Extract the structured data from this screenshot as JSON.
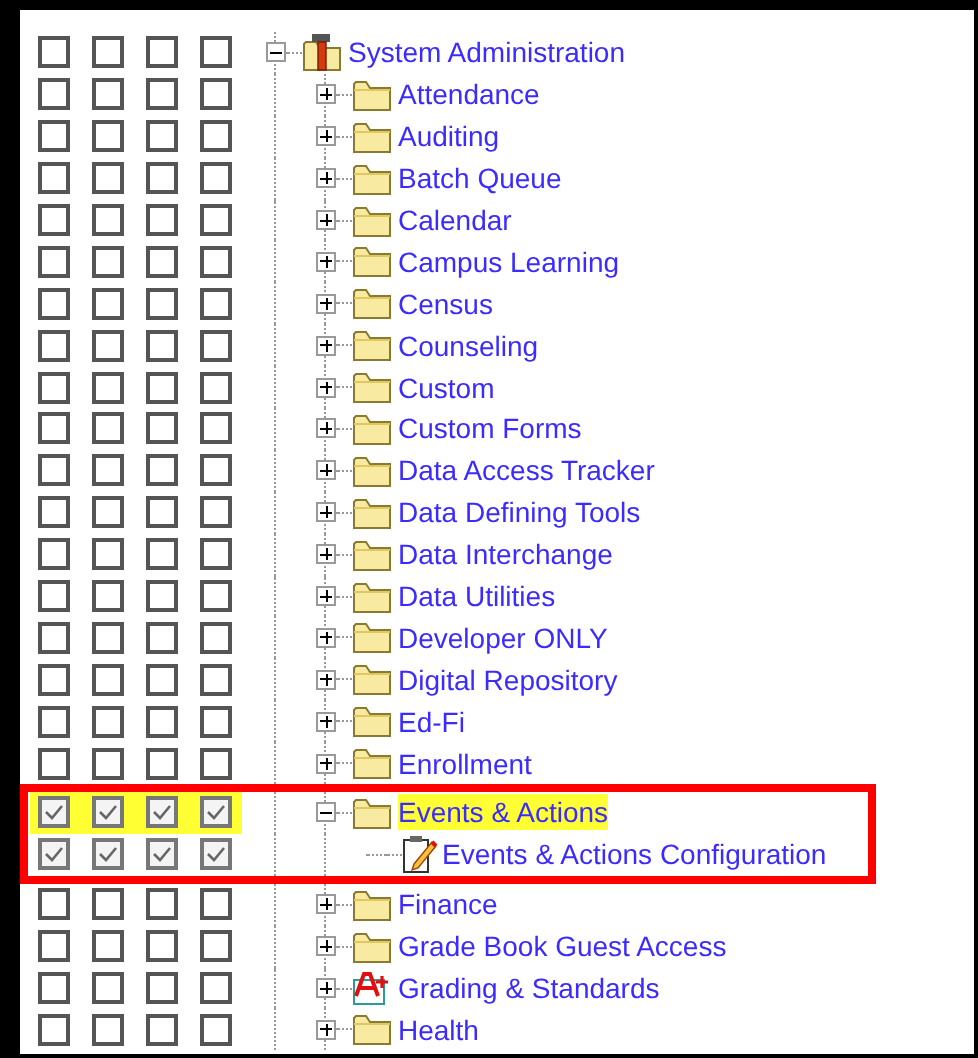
{
  "tree": [
    {
      "label": "System Administration",
      "kind": "tools",
      "expanded": true,
      "selected": false,
      "checks": [
        false,
        false,
        false,
        false
      ],
      "children": [
        {
          "label": "Attendance",
          "kind": "folder",
          "expanded": false,
          "selected": false,
          "checks": [
            false,
            false,
            false,
            false
          ]
        },
        {
          "label": "Auditing",
          "kind": "folder",
          "expanded": false,
          "selected": false,
          "checks": [
            false,
            false,
            false,
            false
          ]
        },
        {
          "label": "Batch Queue",
          "kind": "folder",
          "expanded": false,
          "selected": false,
          "checks": [
            false,
            false,
            false,
            false
          ]
        },
        {
          "label": "Calendar",
          "kind": "folder",
          "expanded": false,
          "selected": false,
          "checks": [
            false,
            false,
            false,
            false
          ]
        },
        {
          "label": "Campus Learning",
          "kind": "folder",
          "expanded": false,
          "selected": false,
          "checks": [
            false,
            false,
            false,
            false
          ]
        },
        {
          "label": "Census",
          "kind": "folder",
          "expanded": false,
          "selected": false,
          "checks": [
            false,
            false,
            false,
            false
          ]
        },
        {
          "label": "Counseling",
          "kind": "folder",
          "expanded": false,
          "selected": false,
          "checks": [
            false,
            false,
            false,
            false
          ]
        },
        {
          "label": "Custom",
          "kind": "folder",
          "expanded": false,
          "selected": false,
          "checks": [
            false,
            false,
            false,
            false
          ]
        },
        {
          "label": "Custom Forms",
          "kind": "folder",
          "expanded": false,
          "selected": false,
          "checks": [
            false,
            false,
            false,
            false
          ]
        },
        {
          "label": "Data Access Tracker",
          "kind": "folder",
          "expanded": false,
          "selected": false,
          "checks": [
            false,
            false,
            false,
            false
          ]
        },
        {
          "label": "Data Defining Tools",
          "kind": "folder",
          "expanded": false,
          "selected": false,
          "checks": [
            false,
            false,
            false,
            false
          ]
        },
        {
          "label": "Data Interchange",
          "kind": "folder",
          "expanded": false,
          "selected": false,
          "checks": [
            false,
            false,
            false,
            false
          ]
        },
        {
          "label": "Data Utilities",
          "kind": "folder",
          "expanded": false,
          "selected": false,
          "checks": [
            false,
            false,
            false,
            false
          ]
        },
        {
          "label": "Developer ONLY",
          "kind": "folder",
          "expanded": false,
          "selected": false,
          "checks": [
            false,
            false,
            false,
            false
          ]
        },
        {
          "label": "Digital Repository",
          "kind": "folder",
          "expanded": false,
          "selected": false,
          "checks": [
            false,
            false,
            false,
            false
          ]
        },
        {
          "label": "Ed-Fi",
          "kind": "folder",
          "expanded": false,
          "selected": false,
          "checks": [
            false,
            false,
            false,
            false
          ]
        },
        {
          "label": "Enrollment",
          "kind": "folder",
          "expanded": false,
          "selected": false,
          "checks": [
            false,
            false,
            false,
            false
          ]
        },
        {
          "label": "Events & Actions",
          "kind": "folder",
          "expanded": true,
          "selected": true,
          "checks": [
            true,
            true,
            true,
            true
          ],
          "children": [
            {
              "label": "Events & Actions Configuration",
              "kind": "document",
              "selected": false,
              "checks": [
                true,
                true,
                true,
                true
              ]
            }
          ]
        },
        {
          "label": "Finance",
          "kind": "folder",
          "expanded": false,
          "selected": false,
          "checks": [
            false,
            false,
            false,
            false
          ]
        },
        {
          "label": "Grade Book Guest Access",
          "kind": "folder",
          "expanded": false,
          "selected": false,
          "checks": [
            false,
            false,
            false,
            false
          ]
        },
        {
          "label": "Grading & Standards",
          "kind": "grading",
          "expanded": false,
          "selected": false,
          "checks": [
            false,
            false,
            false,
            false
          ]
        },
        {
          "label": "Health",
          "kind": "folder",
          "expanded": false,
          "selected": false,
          "checks": [
            false,
            false,
            false,
            false
          ]
        }
      ]
    }
  ]
}
